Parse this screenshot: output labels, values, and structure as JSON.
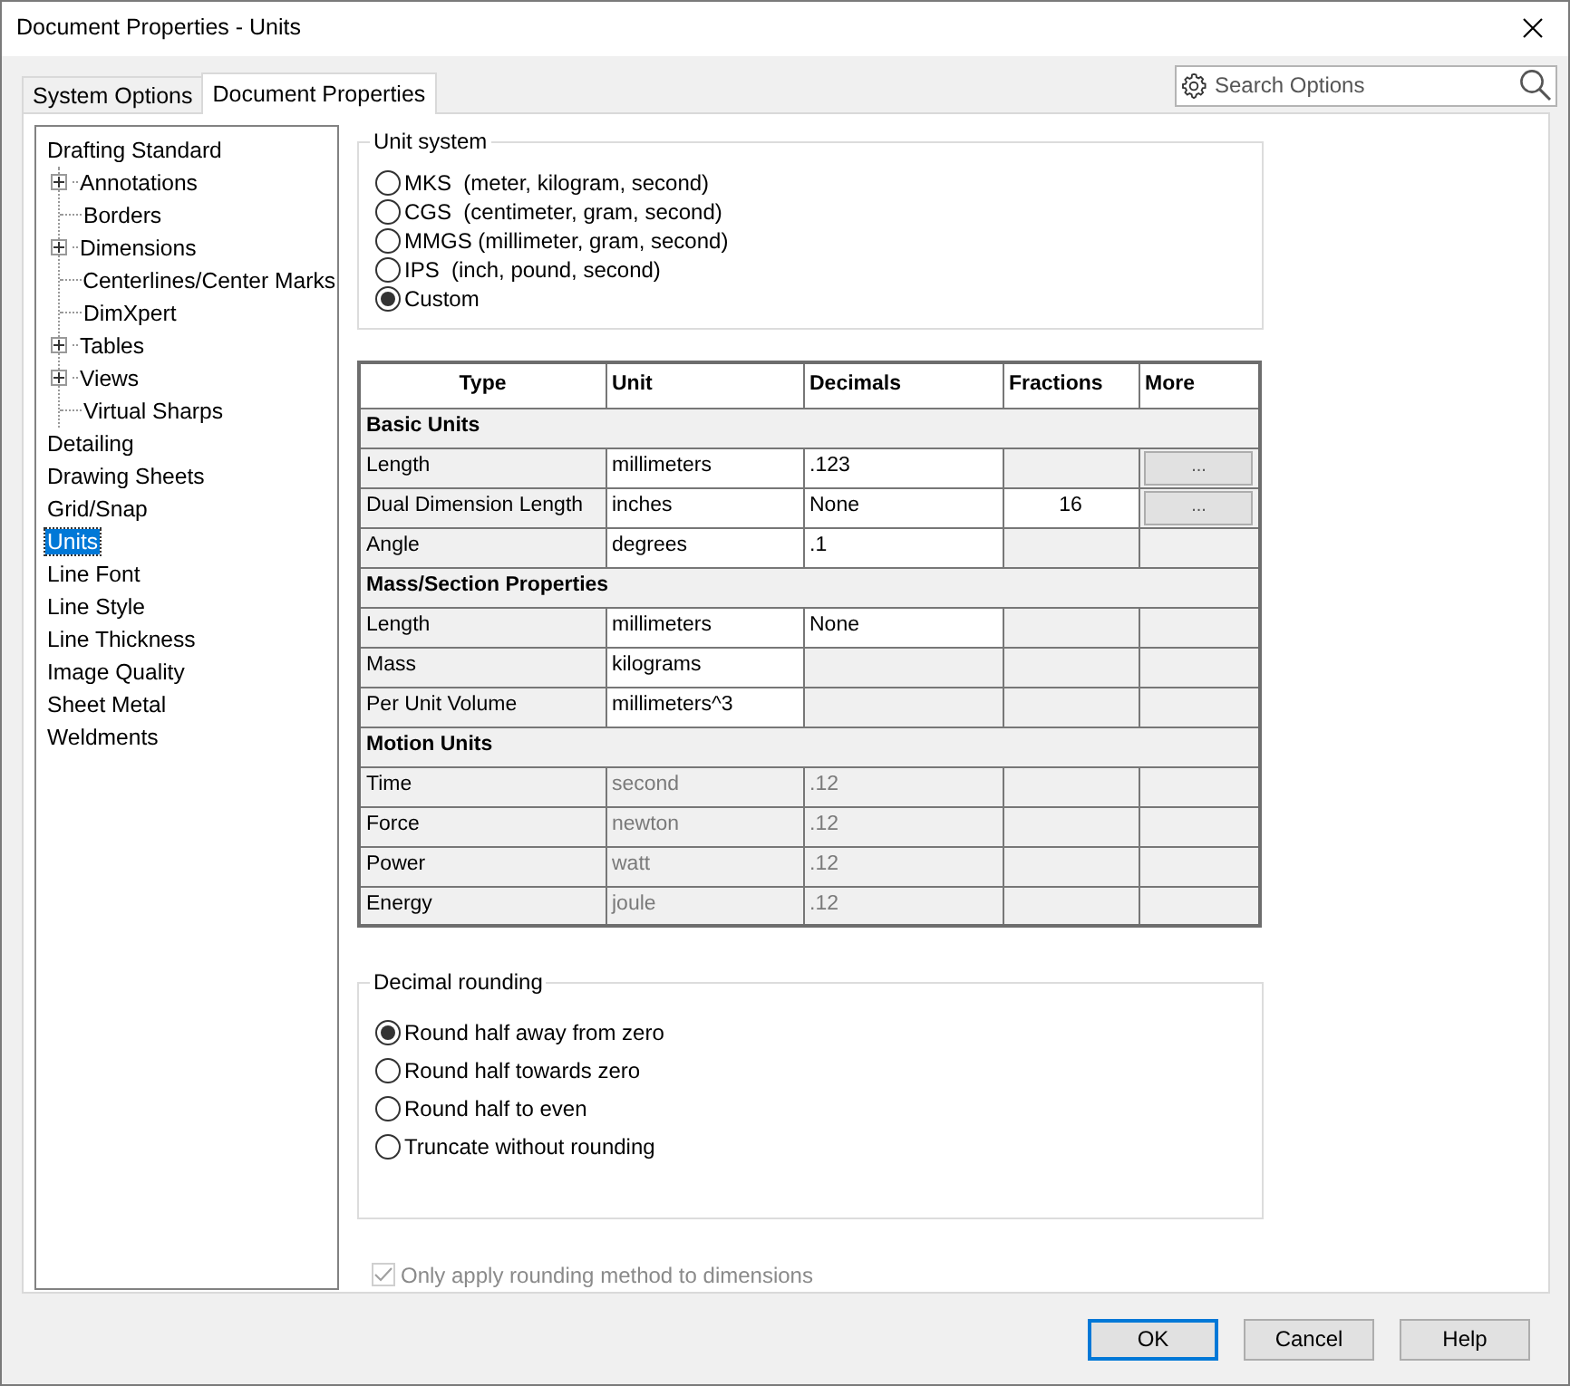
{
  "window": {
    "title": "Document Properties - Units"
  },
  "tabs": [
    {
      "label": "System Options",
      "selected": false
    },
    {
      "label": "Document Properties",
      "selected": true
    }
  ],
  "search": {
    "placeholder": "Search Options"
  },
  "tree": [
    {
      "label": "Drafting Standard",
      "selected": false,
      "children": [
        {
          "label": "Annotations",
          "selected": false,
          "expanded": false
        },
        {
          "label": "Borders",
          "selected": false
        },
        {
          "label": "Dimensions",
          "selected": false,
          "expanded": false
        },
        {
          "label": "Centerlines/Center Marks",
          "selected": false
        },
        {
          "label": "DimXpert",
          "selected": false
        },
        {
          "label": "Tables",
          "selected": false,
          "expanded": false
        },
        {
          "label": "Views",
          "selected": false,
          "expanded": false
        },
        {
          "label": "Virtual Sharps",
          "selected": false
        }
      ]
    },
    {
      "label": "Detailing",
      "selected": false
    },
    {
      "label": "Drawing Sheets",
      "selected": false
    },
    {
      "label": "Grid/Snap",
      "selected": false
    },
    {
      "label": "Units",
      "selected": true
    },
    {
      "label": "Line Font",
      "selected": false
    },
    {
      "label": "Line Style",
      "selected": false
    },
    {
      "label": "Line Thickness",
      "selected": false
    },
    {
      "label": "Image Quality",
      "selected": false
    },
    {
      "label": "Sheet Metal",
      "selected": false
    },
    {
      "label": "Weldments",
      "selected": false
    }
  ],
  "unit_system": {
    "title": "Unit system",
    "options": [
      {
        "label": "MKS  (meter, kilogram, second)",
        "selected": false
      },
      {
        "label": "CGS  (centimeter, gram, second)",
        "selected": false
      },
      {
        "label": "MMGS (millimeter, gram, second)",
        "selected": false
      },
      {
        "label": "IPS  (inch, pound, second)",
        "selected": false
      },
      {
        "label": "Custom",
        "selected": true
      }
    ]
  },
  "units_table": {
    "columns": [
      "Type",
      "Unit",
      "Decimals",
      "Fractions",
      "More"
    ],
    "rows": [
      {
        "kind": "section",
        "label": "Basic Units"
      },
      {
        "kind": "unit",
        "disabled": false,
        "cells": [
          {
            "text": "Length",
            "editable": false
          },
          {
            "text": "millimeters",
            "editable": true
          },
          {
            "text": ".123",
            "editable": true
          },
          {
            "editable": false
          },
          {
            "kind": "button",
            "text": "...",
            "editable": false
          }
        ]
      },
      {
        "kind": "unit",
        "disabled": false,
        "cells": [
          {
            "text": "Dual Dimension Length",
            "editable": false
          },
          {
            "text": "inches",
            "editable": true
          },
          {
            "text": "None",
            "editable": true
          },
          {
            "text": "16",
            "editable": true
          },
          {
            "kind": "button",
            "text": "...",
            "editable": false
          }
        ]
      },
      {
        "kind": "unit",
        "disabled": false,
        "cells": [
          {
            "text": "Angle",
            "editable": false
          },
          {
            "text": "degrees",
            "editable": true
          },
          {
            "text": ".1",
            "editable": true
          },
          {
            "editable": false
          },
          {
            "editable": false
          }
        ]
      },
      {
        "kind": "section",
        "label": "Mass/Section Properties"
      },
      {
        "kind": "unit",
        "disabled": false,
        "cells": [
          {
            "text": "Length",
            "editable": false
          },
          {
            "text": "millimeters",
            "editable": true
          },
          {
            "text": "None",
            "editable": true
          },
          {
            "editable": false
          },
          {
            "editable": false
          }
        ]
      },
      {
        "kind": "unit",
        "disabled": false,
        "cells": [
          {
            "text": "Mass",
            "editable": false
          },
          {
            "text": "kilograms",
            "editable": true
          },
          {
            "editable": false
          },
          {
            "editable": false
          },
          {
            "editable": false
          }
        ]
      },
      {
        "kind": "unit",
        "disabled": false,
        "cells": [
          {
            "text": "Per Unit Volume",
            "editable": false
          },
          {
            "text": "millimeters^3",
            "editable": true
          },
          {
            "editable": false
          },
          {
            "editable": false
          },
          {
            "editable": false
          }
        ]
      },
      {
        "kind": "section",
        "label": "Motion Units"
      },
      {
        "kind": "unit",
        "disabled": true,
        "cells": [
          {
            "text": "Time",
            "editable": false
          },
          {
            "text": "second",
            "editable": false
          },
          {
            "text": ".12",
            "editable": false
          },
          {
            "editable": false
          },
          {
            "editable": false
          }
        ]
      },
      {
        "kind": "unit",
        "disabled": true,
        "cells": [
          {
            "text": "Force",
            "editable": false
          },
          {
            "text": "newton",
            "editable": false
          },
          {
            "text": ".12",
            "editable": false
          },
          {
            "editable": false
          },
          {
            "editable": false
          }
        ]
      },
      {
        "kind": "unit",
        "disabled": true,
        "cells": [
          {
            "text": "Power",
            "editable": false
          },
          {
            "text": "watt",
            "editable": false
          },
          {
            "text": ".12",
            "editable": false
          },
          {
            "editable": false
          },
          {
            "editable": false
          }
        ]
      },
      {
        "kind": "unit",
        "disabled": true,
        "cells": [
          {
            "text": "Energy",
            "editable": false
          },
          {
            "text": "joule",
            "editable": false
          },
          {
            "text": ".12",
            "editable": false
          },
          {
            "editable": false
          },
          {
            "editable": false
          }
        ]
      }
    ]
  },
  "decimal_rounding": {
    "title": "Decimal rounding",
    "options": [
      {
        "label": "Round half away from zero",
        "selected": true
      },
      {
        "label": "Round half towards zero",
        "selected": false
      },
      {
        "label": "Round half to even",
        "selected": false
      },
      {
        "label": "Truncate without rounding",
        "selected": false
      }
    ]
  },
  "rounding_checkbox": {
    "label": "Only apply rounding method to dimensions",
    "checked": true,
    "disabled": true
  },
  "buttons": [
    {
      "label": "OK",
      "default": true
    },
    {
      "label": "Cancel",
      "default": false
    },
    {
      "label": "Help",
      "default": false
    }
  ]
}
